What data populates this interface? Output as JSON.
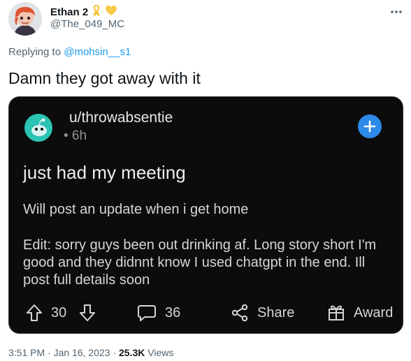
{
  "author": {
    "name": "Ethan 2",
    "handle": "@The_049_MC",
    "badges": [
      "ribbon-icon",
      "yellow-heart-icon"
    ]
  },
  "reply": {
    "prefix": "Replying to",
    "mention": "@mohsin__s1"
  },
  "tweet_text": "Damn they got away with it",
  "embedded_post": {
    "username": "u/throwabsentie",
    "time": "• 6h",
    "title": "just had my meeting",
    "body": [
      "Will post an update when i get home",
      "Edit: sorry guys been out drinking af. Long story short I'm good and they didnnt know I used chatgpt in the end. Ill post full details soon"
    ],
    "upvotes": "30",
    "comments": "36",
    "share_label": "Share",
    "award_label": "Award",
    "colors": {
      "accent": "#2d8ae8",
      "avatar": "#2bc3b4",
      "background": "#0c0c0d"
    }
  },
  "meta": {
    "time": "3:51 PM",
    "separator": "·",
    "date": "Jan 16, 2023",
    "views_count": "25.3K",
    "views_label": "Views"
  },
  "colors": {
    "link": "#1d9bf0",
    "secondary_text": "#536471"
  }
}
